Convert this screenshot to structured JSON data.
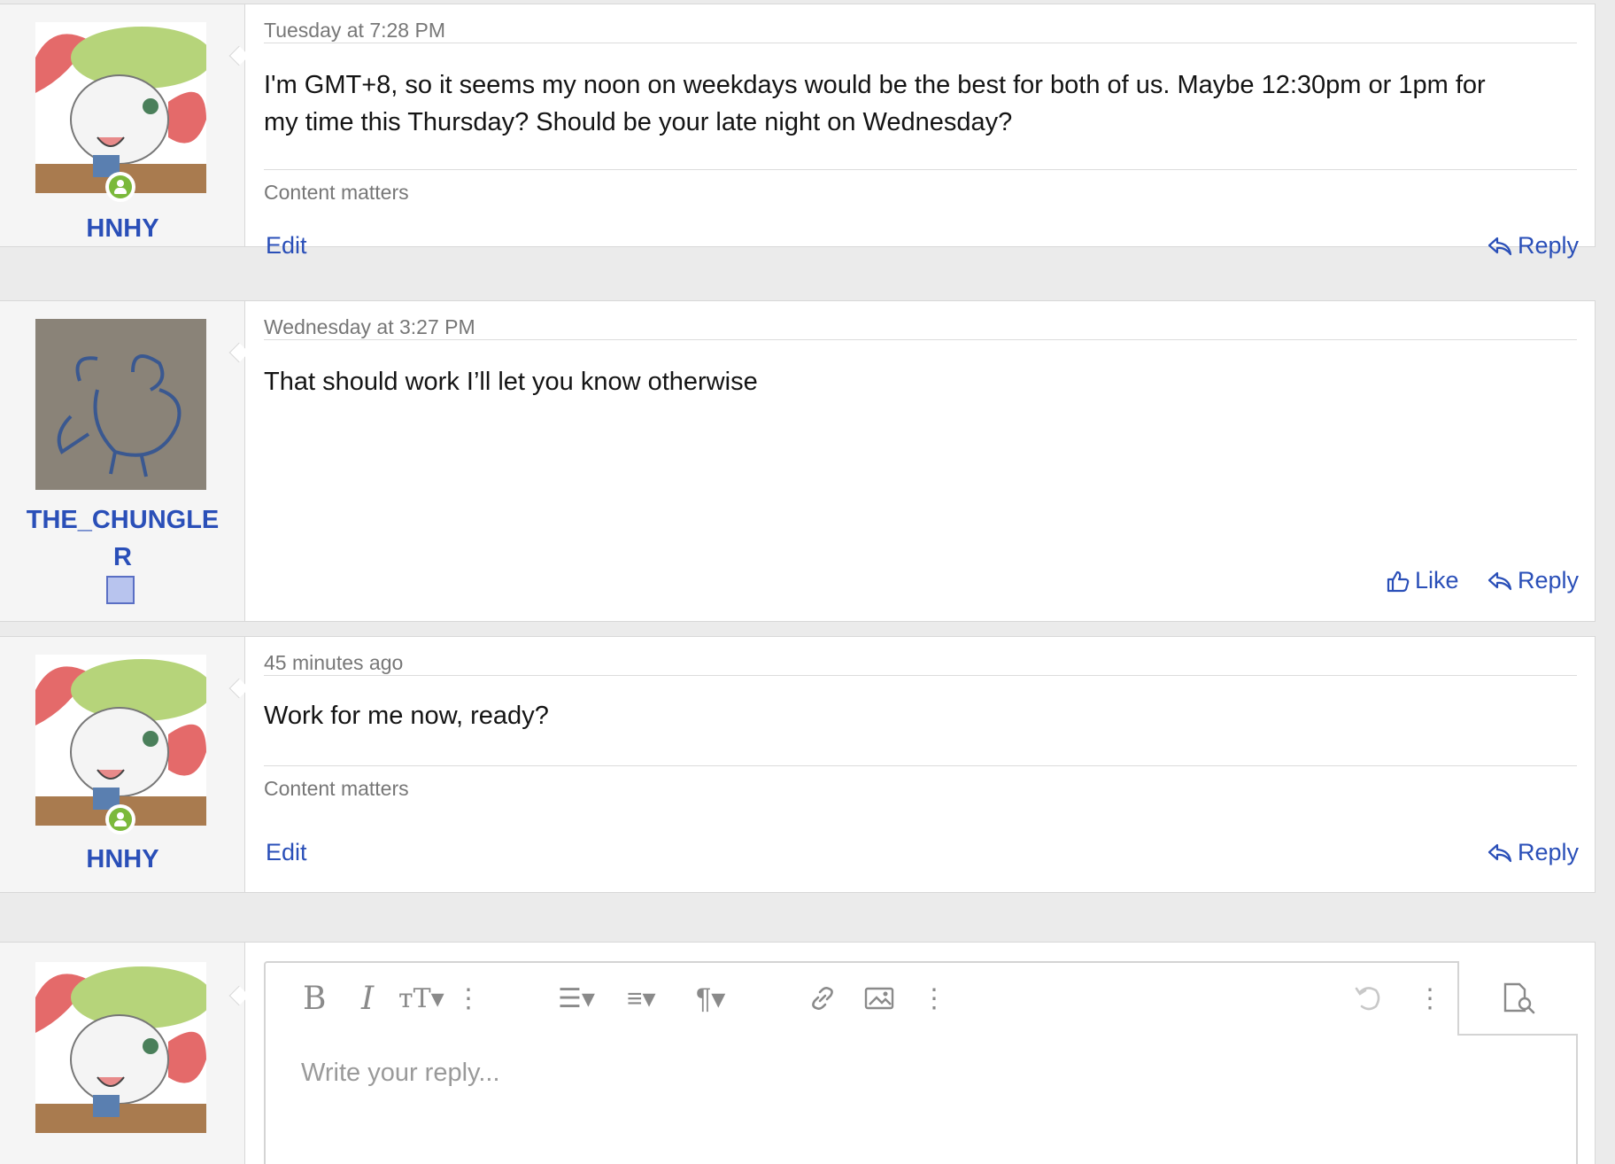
{
  "posts": [
    {
      "username": "HNHY",
      "date": "Tuesday at 7:28 PM",
      "lines": [
        "I'm GMT+8, so it seems my noon on weekdays would be the best for both of us. Maybe 12:30pm or 1pm for",
        "my time this Thursday? Should be your late night on Wednesday?"
      ],
      "signature": "Content matters",
      "edit_label": "Edit",
      "reply_label": "Reply"
    },
    {
      "username_line1": "THE_CHUNGLE",
      "username_line2": "R",
      "date": "Wednesday at 3:27 PM",
      "lines": [
        "That should work I’ll let you know otherwise"
      ],
      "like_label": "Like",
      "reply_label": "Reply"
    },
    {
      "username": "HNHY",
      "date": "45 minutes ago",
      "lines": [
        "Work for me now, ready?"
      ],
      "signature": "Content matters",
      "edit_label": "Edit",
      "reply_label": "Reply"
    }
  ],
  "editor": {
    "placeholder": "Write your reply...",
    "toolbar_icons": [
      "bold-icon",
      "italic-icon",
      "text-size-icon",
      "more-text-icon",
      "list-icon",
      "align-icon",
      "paragraph-icon",
      "link-icon",
      "image-icon",
      "more-insert-icon",
      "undo-icon",
      "more-options-icon",
      "preview-icon"
    ]
  },
  "colors": {
    "link": "#2a4fb8",
    "online": "#7bb93b"
  }
}
